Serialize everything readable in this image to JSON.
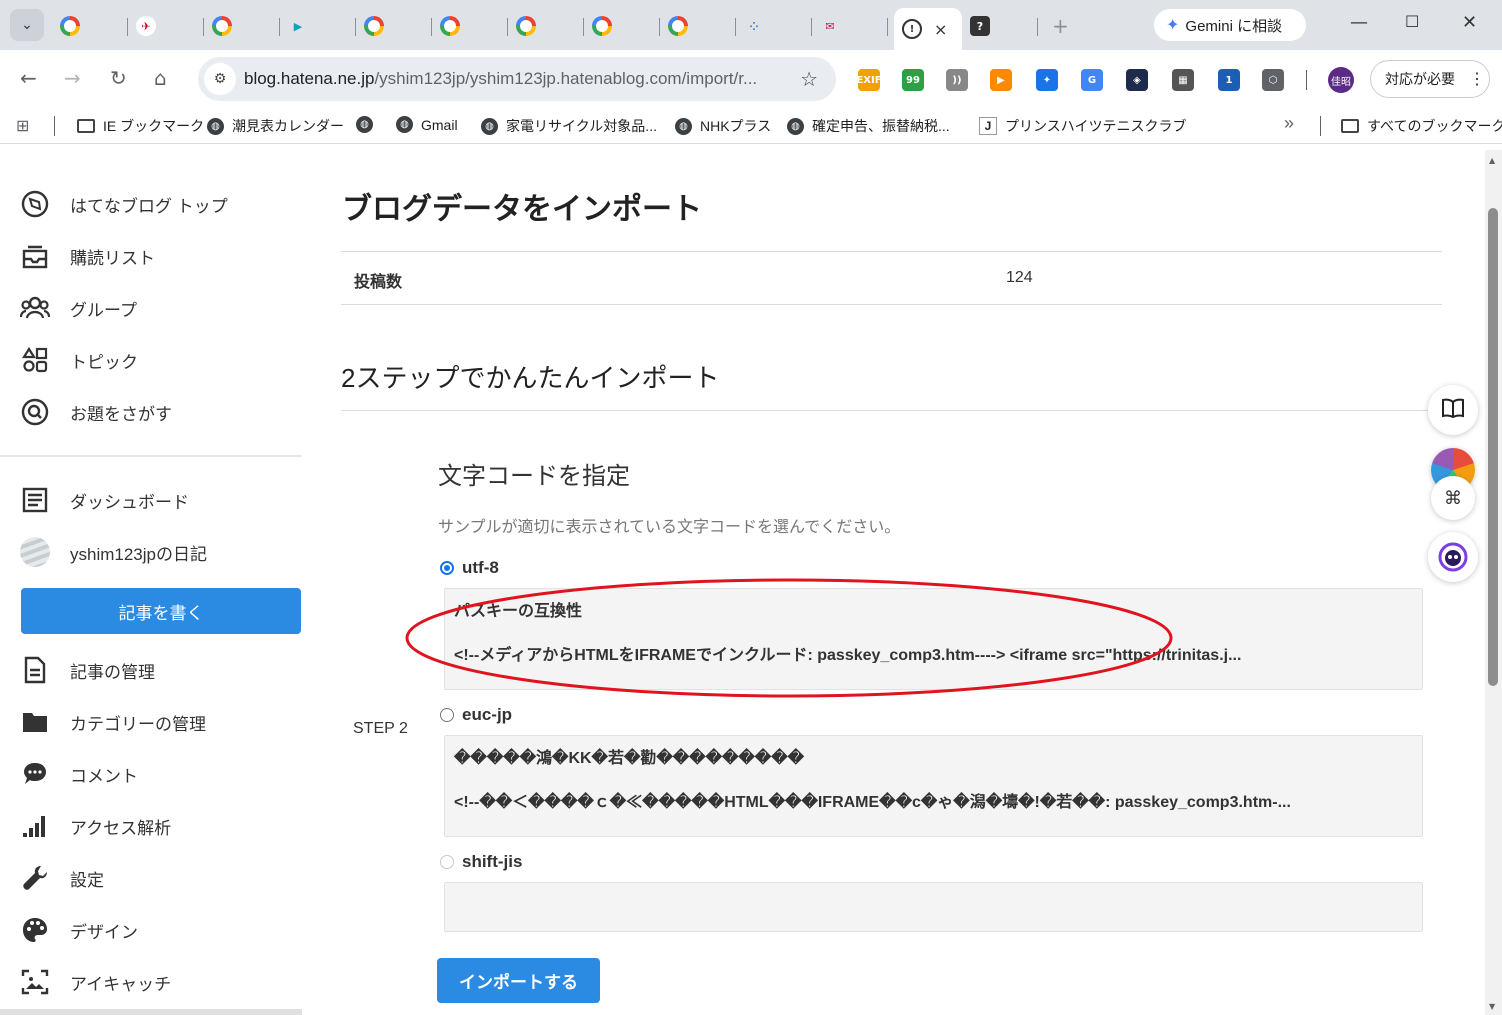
{
  "browser": {
    "tab_count": 12,
    "active_tab_close": "×",
    "new_tab": "+",
    "gemini_label": "Gemini に相談",
    "url_domain": "blog.hatena.ne.jp",
    "url_rest": "/yshim123jp/yshim123jp.hatenablog.com/import/r...",
    "profile_initials": "佳昭",
    "action_required": "対応が必要",
    "extensions": [
      {
        "name": "exif-icon",
        "label": "EXIF",
        "color": "#f2a100"
      },
      {
        "name": "quote-icon",
        "label": "99",
        "color": "#2f9e44"
      },
      {
        "name": "rss-icon",
        "label": "))",
        "color": "#888888"
      },
      {
        "name": "play-icon",
        "label": "▶",
        "color": "#ff8a00"
      },
      {
        "name": "gamepad-icon",
        "label": "✦",
        "color": "#1a73e8"
      },
      {
        "name": "translate-icon",
        "label": "G",
        "color": "#4285f4"
      },
      {
        "name": "compass-icon",
        "label": "◈",
        "color": "#1f2b4d"
      },
      {
        "name": "qr-icon",
        "label": "▦",
        "color": "#555555"
      },
      {
        "name": "badge-ext-icon",
        "label": "1",
        "color": "#1a5fb4"
      },
      {
        "name": "puzzle-icon",
        "label": "⬡",
        "color": "#5f6368"
      }
    ]
  },
  "bookmarks": {
    "items": [
      {
        "label": "IE ブックマーク",
        "icon": "folder"
      },
      {
        "label": "潮見表カレンダー",
        "icon": "globe"
      },
      {
        "label": "",
        "icon": "globe"
      },
      {
        "label": "Gmail",
        "icon": "globe"
      },
      {
        "label": "家電リサイクル対象品...",
        "icon": "globe"
      },
      {
        "label": "NHKプラス",
        "icon": "globe"
      },
      {
        "label": "確定申告、振替納税...",
        "icon": "globe"
      },
      {
        "label": "プリンスハイツテニスクラブ",
        "icon": "j"
      }
    ],
    "overflow": "»",
    "all_bookmarks": "すべてのブックマーク"
  },
  "sidebar": {
    "top_items": [
      {
        "label": "はてなブログ トップ",
        "icon": "compass-icon"
      },
      {
        "label": "購読リスト",
        "icon": "inbox-icon"
      },
      {
        "label": "グループ",
        "icon": "group-icon"
      },
      {
        "label": "トピック",
        "icon": "topic-icon"
      },
      {
        "label": "お題をさがす",
        "icon": "search-q-icon"
      }
    ],
    "dashboard": "ダッシュボード",
    "blog_name": "yshim123jpの日記",
    "write_button": "記事を書く",
    "manage_items": [
      {
        "label": "記事の管理",
        "icon": "document-icon"
      },
      {
        "label": "カテゴリーの管理",
        "icon": "folder-icon"
      },
      {
        "label": "コメント",
        "icon": "comment-icon"
      },
      {
        "label": "アクセス解析",
        "icon": "bar-chart-icon"
      },
      {
        "label": "設定",
        "icon": "wrench-icon"
      },
      {
        "label": "デザイン",
        "icon": "palette-icon"
      },
      {
        "label": "アイキャッチ",
        "icon": "image-icon"
      }
    ]
  },
  "main": {
    "page_title": "ブログデータをインポート",
    "stat_label": "投稿数",
    "stat_value": "124",
    "subtitle": "2ステップでかんたんインポート",
    "step_label": "STEP 2",
    "section_title": "文字コードを指定",
    "section_desc": "サンプルが適切に表示されている文字コードを選んでください。",
    "encodings": [
      {
        "label": "utf-8",
        "selected": true,
        "line1": "パスキーの互換性",
        "line2": "<!--メディアからHTMLをIFRAMEでインクルード: passkey_comp3.htm----> <iframe src=\"https://trinitas.j..."
      },
      {
        "label": "euc-jp",
        "selected": false,
        "line1": "�����鴻�KK�若�勸���������",
        "line2": "<!--��＜����ｃ�≪�����HTML���IFRAME��c�ゃ�潟�壔�!�若��: passkey_comp3.htm-..."
      },
      {
        "label": "shift-jis",
        "selected": false,
        "line1": "",
        "line2": ""
      }
    ],
    "import_button": "インポートする"
  },
  "annotation": {
    "shape": "ellipse",
    "color": "#e0141e"
  }
}
